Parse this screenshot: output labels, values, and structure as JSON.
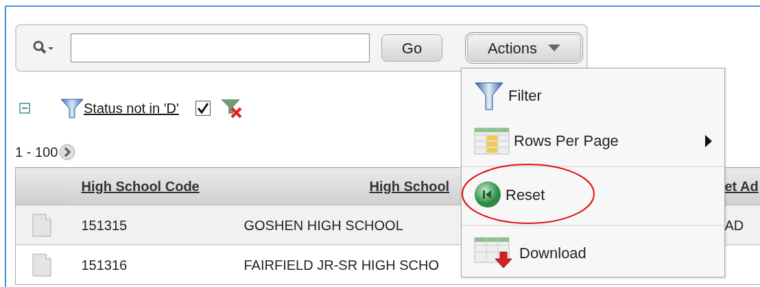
{
  "toolbar": {
    "go_button": "Go",
    "actions_button": {
      "label": "Actions",
      "focused": true
    }
  },
  "filters": [
    {
      "label": "Status not in 'D'",
      "enabled": true
    }
  ],
  "pagination": {
    "range": "1 - 100"
  },
  "table": {
    "columns": [
      {
        "label": "High School Code"
      },
      {
        "label": "High School"
      },
      {
        "label": "et Ad"
      }
    ],
    "rows": [
      {
        "cells": [
          "151315",
          "GOSHEN HIGH SCHOOL",
          "AD"
        ],
        "selected": true
      },
      {
        "cells": [
          "151316",
          "FAIRFIELD JR-SR HIGH SCHO"
        ],
        "selected": false
      }
    ]
  },
  "actions_menu": {
    "groups": [
      [
        {
          "kind": "filter",
          "label": "Filter",
          "submenu": false,
          "circled": false
        },
        {
          "kind": "rows",
          "label": "Rows Per Page",
          "submenu": true,
          "circled": false
        }
      ],
      [
        {
          "kind": "reset",
          "label": "Reset",
          "submenu": false,
          "circled": true
        }
      ],
      [
        {
          "kind": "download",
          "label": "Download",
          "submenu": false,
          "circled": false
        }
      ]
    ]
  }
}
